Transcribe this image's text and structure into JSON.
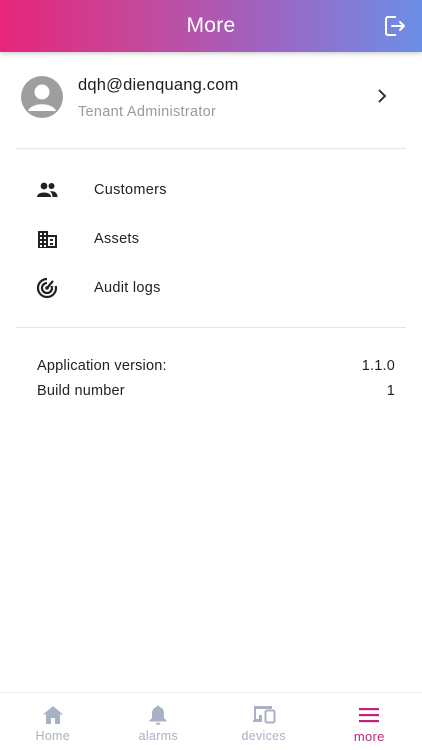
{
  "header": {
    "title": "More",
    "logout_icon": "logout-icon"
  },
  "profile": {
    "email": "dqh@dienquang.com",
    "role": "Tenant Administrator"
  },
  "menu": [
    {
      "label": "Customers",
      "icon": "customers-icon"
    },
    {
      "label": "Assets",
      "icon": "assets-icon"
    },
    {
      "label": "Audit logs",
      "icon": "audit-logs-icon"
    }
  ],
  "info": {
    "app_version_label": "Application version:",
    "app_version_value": "1.1.0",
    "build_label": "Build number",
    "build_value": "1"
  },
  "bottom_nav": [
    {
      "label": "Home",
      "icon": "home-icon",
      "active": false
    },
    {
      "label": "alarms",
      "icon": "bell-icon",
      "active": false
    },
    {
      "label": "devices",
      "icon": "devices-icon",
      "active": false
    },
    {
      "label": "more",
      "icon": "menu-icon",
      "active": true
    }
  ],
  "colors": {
    "accent": "#c2237a",
    "gradient_start": "#e5267b",
    "gradient_end": "#6c8fe6",
    "nav_inactive": "#a9b1c4"
  }
}
